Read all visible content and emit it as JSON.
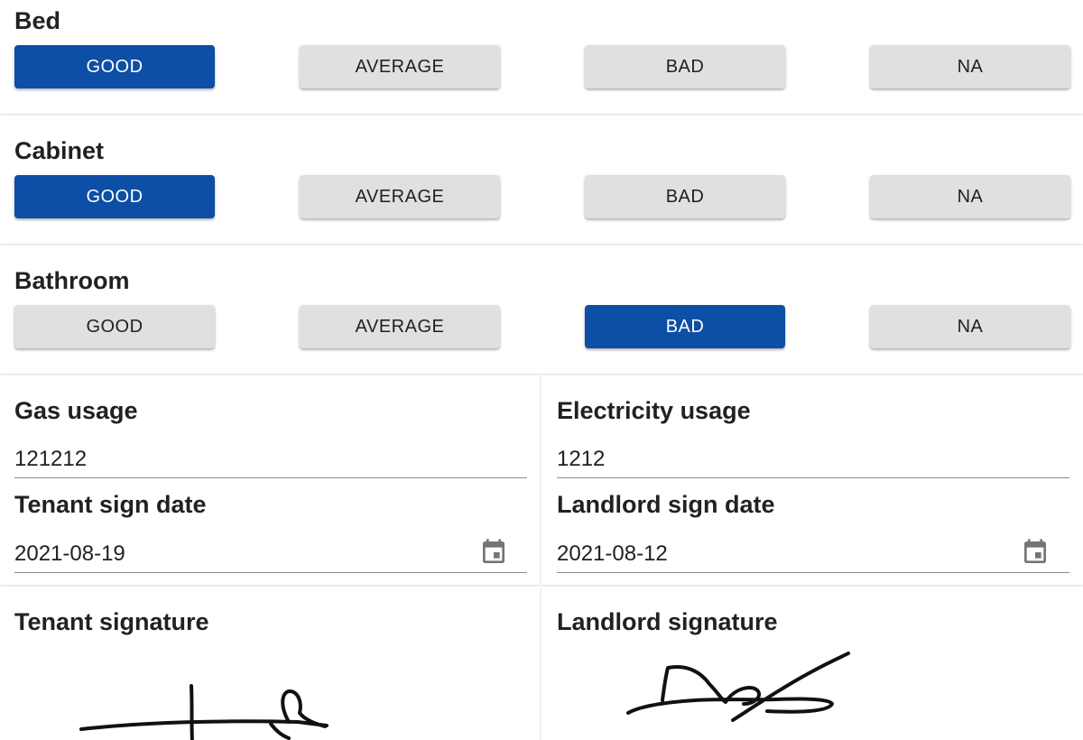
{
  "condition_options": [
    "GOOD",
    "AVERAGE",
    "BAD",
    "NA"
  ],
  "items": [
    {
      "label": "Bed",
      "selected": "GOOD"
    },
    {
      "label": "Cabinet",
      "selected": "GOOD"
    },
    {
      "label": "Bathroom",
      "selected": "BAD"
    }
  ],
  "meters": {
    "gas_label": "Gas usage",
    "gas_value": "121212",
    "electricity_label": "Electricity usage",
    "electricity_value": "1212"
  },
  "dates": {
    "tenant_label": "Tenant sign date",
    "tenant_value": "2021-08-19",
    "landlord_label": "Landlord sign date",
    "landlord_value": "2021-08-12"
  },
  "signatures": {
    "tenant_label": "Tenant signature",
    "landlord_label": "Landlord signature"
  },
  "colors": {
    "selected_button": "#0d4ea6",
    "unselected_button": "#e0e0e0"
  },
  "icons": {
    "date_picker": "calendar-icon"
  }
}
